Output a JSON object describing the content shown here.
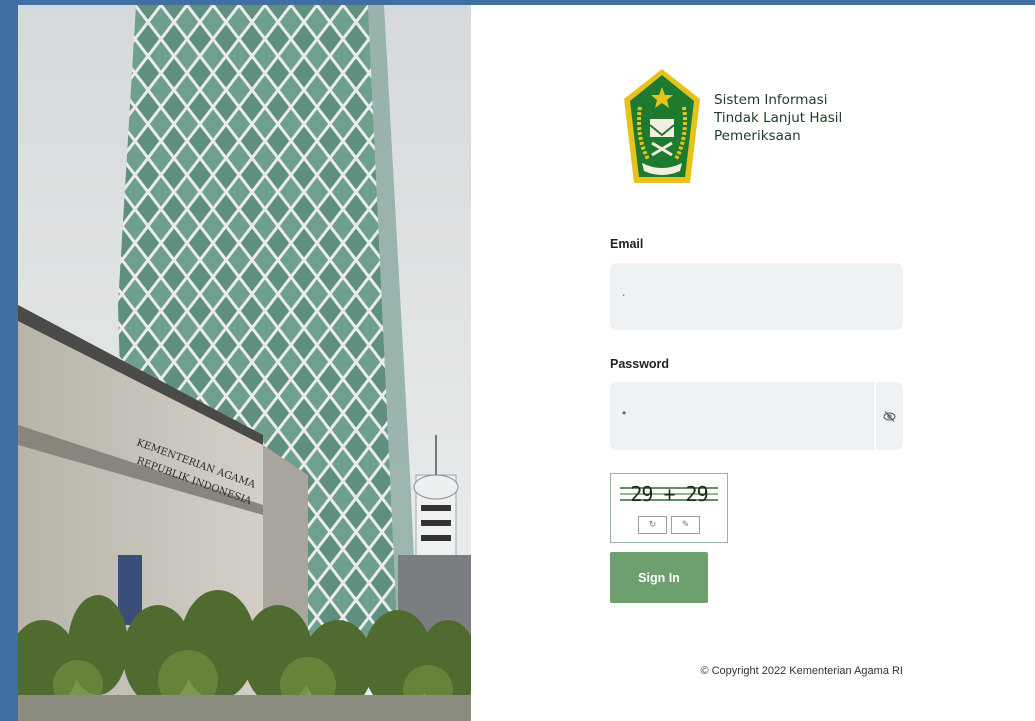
{
  "app": {
    "title_lines": [
      "Sistem Informasi",
      "Tindak Lanjut Hasil",
      "Pemeriksaan"
    ]
  },
  "building_sign": {
    "line1": "KEMENTERIAN AGAMA",
    "line2": "REPUBLIK INDONESIA"
  },
  "form": {
    "email_label": "Email",
    "email_value": ".",
    "password_label": "Password",
    "password_value": "•",
    "captcha_text": "29 + 29",
    "refresh_icon": "refresh-icon",
    "edit_icon": "pencil-icon",
    "eye_icon": "eye-slash-icon",
    "signin_label": "Sign In"
  },
  "footer": {
    "copyright": "© Copyright 2022 Kementerian Agama RI"
  },
  "colors": {
    "accent_green": "#6ea06f",
    "input_bg": "#eef2f5",
    "outer_frame": "#3f6fa3",
    "logo_green": "#1e7a2e",
    "logo_gold": "#e6c21a"
  }
}
